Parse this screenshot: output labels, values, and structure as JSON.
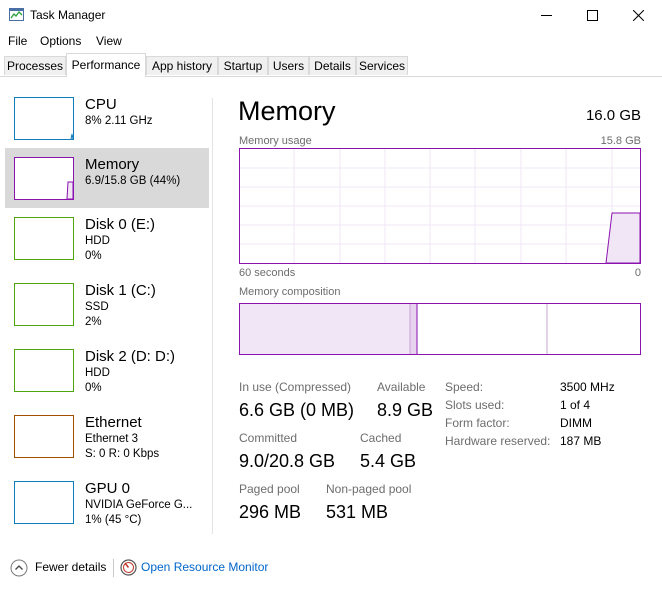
{
  "window": {
    "title": "Task Manager",
    "icon": "task-manager-icon",
    "controls": [
      "minimize-icon",
      "maximize-icon",
      "close-icon"
    ]
  },
  "menu": [
    "File",
    "Options",
    "View"
  ],
  "tabs": [
    {
      "label": "Processes",
      "active": false
    },
    {
      "label": "Performance",
      "active": true
    },
    {
      "label": "App history",
      "active": false
    },
    {
      "label": "Startup",
      "active": false
    },
    {
      "label": "Users",
      "active": false
    },
    {
      "label": "Details",
      "active": false
    },
    {
      "label": "Services",
      "active": false
    }
  ],
  "sidebar": [
    {
      "name": "CPU",
      "line1": "8%  2.11 GHz",
      "line2": "",
      "color": "#117dbb",
      "selected": false
    },
    {
      "name": "Memory",
      "line1": "6.9/15.8 GB (44%)",
      "line2": "",
      "color": "#8b12ae",
      "selected": true
    },
    {
      "name": "Disk 0 (E:)",
      "line1": "HDD",
      "line2": "0%",
      "color": "#4da60c",
      "selected": false
    },
    {
      "name": "Disk 1 (C:)",
      "line1": "SSD",
      "line2": "2%",
      "color": "#4da60c",
      "selected": false
    },
    {
      "name": "Disk 2 (D: D:)",
      "line1": "HDD",
      "line2": "0%",
      "color": "#4da60c",
      "selected": false
    },
    {
      "name": "Ethernet",
      "line1": "Ethernet 3",
      "line2": "S: 0  R: 0 Kbps",
      "color": "#a74f01",
      "selected": false
    },
    {
      "name": "GPU 0",
      "line1": "NVIDIA GeForce G...",
      "line2": "1% (45 °C)",
      "color": "#117dbb",
      "selected": false
    }
  ],
  "main": {
    "title": "Memory",
    "total": "16.0 GB",
    "usage_label": "Memory usage",
    "usage_max": "15.8 GB",
    "time_left": "60 seconds",
    "time_right": "0",
    "composition_label": "Memory composition",
    "accent": "#8b12ae",
    "stats": {
      "in_use_label": "In use (Compressed)",
      "in_use": "6.6 GB (0 MB)",
      "available_label": "Available",
      "available": "8.9 GB",
      "committed_label": "Committed",
      "committed": "9.0/20.8 GB",
      "cached_label": "Cached",
      "cached": "5.4 GB",
      "paged_label": "Paged pool",
      "paged": "296 MB",
      "nonpaged_label": "Non-paged pool",
      "nonpaged": "531 MB"
    },
    "specs": [
      {
        "k": "Speed:",
        "v": "3500 MHz"
      },
      {
        "k": "Slots used:",
        "v": "1 of 4"
      },
      {
        "k": "Form factor:",
        "v": "DIMM"
      },
      {
        "k": "Hardware reserved:",
        "v": "187 MB"
      }
    ]
  },
  "footer": {
    "fewer": "Fewer details",
    "open_monitor": "Open Resource Monitor"
  }
}
